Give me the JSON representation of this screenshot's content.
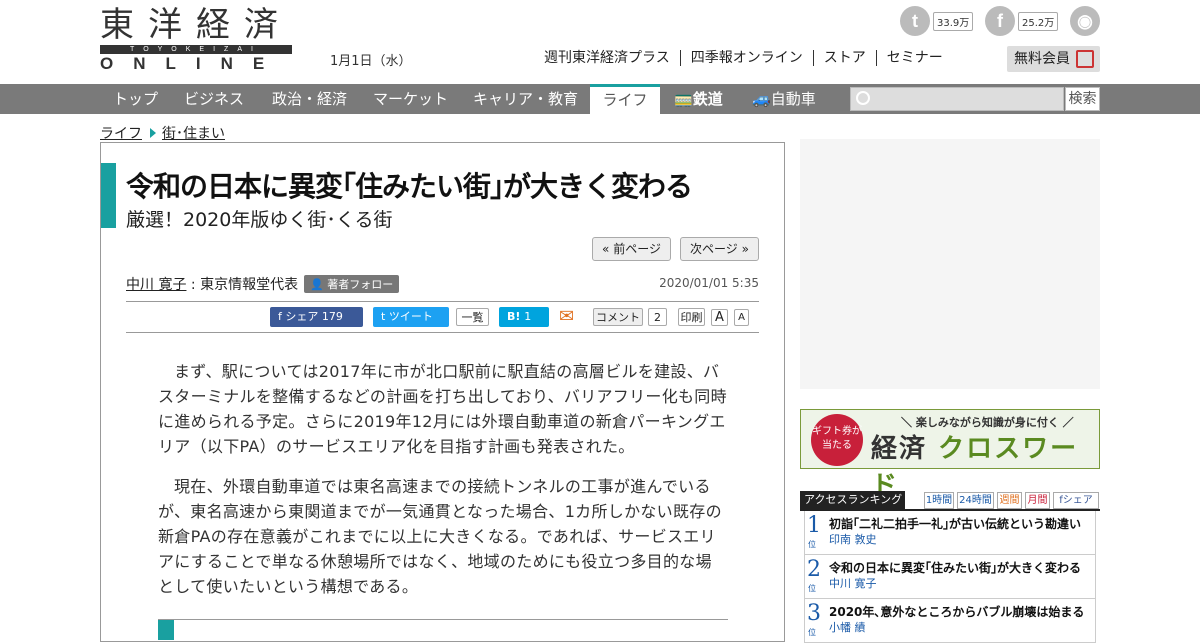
{
  "header": {
    "logo_kanji": "東洋経済",
    "logo_roman": "TOYOKEIZAI",
    "logo_online": "ONLINE",
    "date": "1月1日（水）",
    "topnav": [
      "週刊東洋経済プラス",
      "四季報オンライン",
      "ストア",
      "セミナー"
    ],
    "free_member": "無料会員",
    "social": {
      "twitter_count": "33.9万",
      "facebook_count": "25.2万"
    }
  },
  "gnav": {
    "items": [
      "トップ",
      "ビジネス",
      "政治・経済",
      "マーケット",
      "キャリア・教育",
      "ライフ",
      "鉄道",
      "自動車"
    ],
    "active": "ライフ",
    "search_placeholder": "",
    "search_button": "検索"
  },
  "breadcrumb": {
    "parent": "ライフ",
    "current": "街･住まい"
  },
  "article": {
    "title": "令和の日本に異変｢住みたい街｣が大きく変わる",
    "subtitle": "厳選！2020年版ゆく街･くる街",
    "prev_page": "« 前ページ",
    "next_page": "次ページ »",
    "author_name": "中川 寛子",
    "author_role": "東京情報堂代表",
    "follow_label": "著者フォロー",
    "timestamp": "2020/01/01 5:35",
    "share": {
      "fb_label": "シェア",
      "fb_count": "179",
      "tweet_label": "ツイート",
      "list_label": "一覧",
      "hatena_label": "B!",
      "hatena_count": "1",
      "comment_label": "コメント",
      "comment_count": "2",
      "print_label": "印刷",
      "font_a_large": "A",
      "font_a_small": "A"
    },
    "paragraphs": [
      "まず、駅については2017年に市が北口駅前に駅直結の高層ビルを建設、バスターミナルを整備するなどの計画を打ち出しており、バリアフリー化も同時に進められる予定。さらに2019年12月には外環自動車道の新倉パーキングエリア（以下PA）のサービスエリア化を目指す計画も発表された。",
      "現在、外環自動車道では東名高速までの接続トンネルの工事が進んでいるが、東名高速から東関道までが一気通貫となった場合、1カ所しかない既存の新倉PAの存在意義がこれまでに以上に大きくなる。であれば、サービスエリアにすることで単なる休憩場所ではなく、地域のためにも役立つ多目的な場として使いたいという構想である。"
    ]
  },
  "sidebar": {
    "crossword": {
      "circle_text": "ギフト券が当たる",
      "tagline": "＼ 楽しみながら知識が身に付く ／",
      "title_a": "経済",
      "title_b": "クロスワード"
    },
    "ranking": {
      "header": "アクセスランキング",
      "tabs": [
        "1時間",
        "24時間",
        "週間",
        "月間",
        "シェア"
      ],
      "rank_suffix": "位",
      "items": [
        {
          "rank": "1",
          "title": "初詣｢二礼二拍手一礼｣が古い伝統という勘違い",
          "author": "印南 敦史"
        },
        {
          "rank": "2",
          "title": "令和の日本に異変｢住みたい街｣が大きく変わる",
          "author": "中川 寛子"
        },
        {
          "rank": "3",
          "title": "2020年､意外なところからバブル崩壊は始まる",
          "author": "小幡 績"
        }
      ]
    }
  },
  "colors": {
    "accent": "#19a0a0",
    "nav_bg": "#7a7a7a",
    "rank_blue": "#1a5aa8"
  }
}
